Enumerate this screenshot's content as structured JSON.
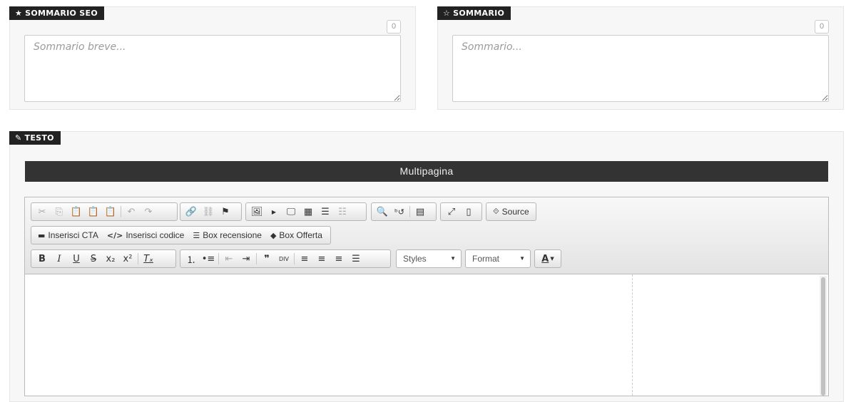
{
  "seo_panel": {
    "label": "SOMMARIO SEO",
    "icon": "star-solid-icon",
    "counter": "0",
    "placeholder": "Sommario breve..."
  },
  "summary_panel": {
    "label": "SOMMARIO",
    "icon": "star-outline-icon",
    "counter": "0",
    "placeholder": "Sommario..."
  },
  "text_panel": {
    "label": "TESTO",
    "icon": "pencil-icon"
  },
  "multipage": "Multipagina",
  "toolbar": {
    "source_label": "Source",
    "cta_label": "Inserisci CTA",
    "code_label": "Inserisci codice",
    "review_label": "Box recensione",
    "offer_label": "Box Offerta",
    "styles_label": "Styles",
    "format_label": "Format",
    "text_color_label": "A"
  }
}
